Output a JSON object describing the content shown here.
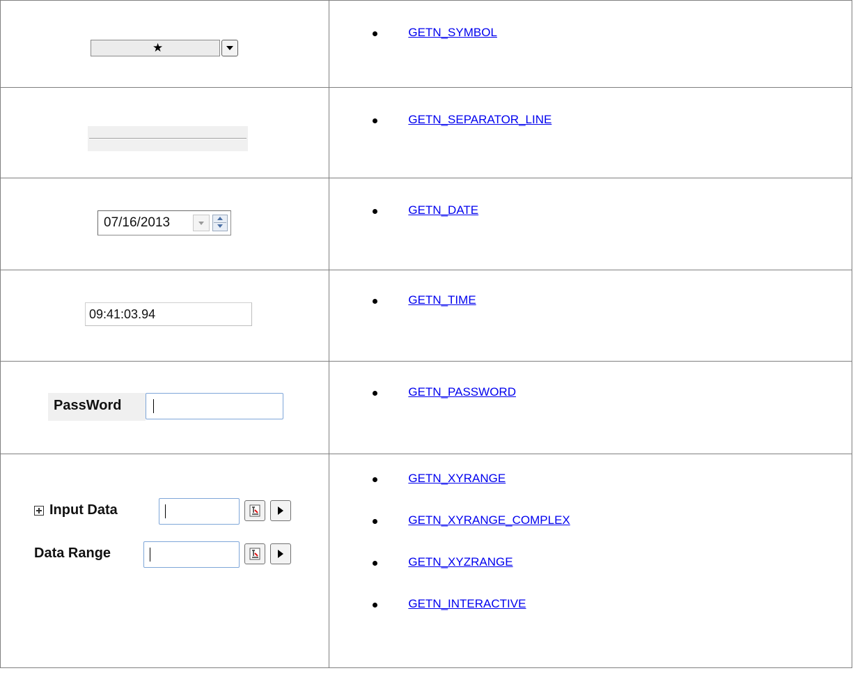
{
  "rows": [
    {
      "control": {
        "type": "symbol",
        "symbol": "★"
      },
      "links": [
        "GETN_SYMBOL"
      ]
    },
    {
      "control": {
        "type": "separator"
      },
      "links": [
        "GETN_SEPARATOR_LINE"
      ]
    },
    {
      "control": {
        "type": "date",
        "value": "07/16/2013"
      },
      "links": [
        "GETN_DATE"
      ]
    },
    {
      "control": {
        "type": "time",
        "value": "09:41:03.94"
      },
      "links": [
        "GETN_TIME"
      ]
    },
    {
      "control": {
        "type": "password",
        "label": "PassWord"
      },
      "links": [
        "GETN_PASSWORD"
      ]
    },
    {
      "control": {
        "type": "range",
        "label_1": "Input Data",
        "label_2": "Data Range"
      },
      "links": [
        "GETN_XYRANGE",
        "GETN_XYRANGE_COMPLEX",
        "GETN_XYZRANGE",
        "GETN_INTERACTIVE"
      ]
    }
  ],
  "colors": {
    "link": "#0000ee",
    "border": "#7f7f7f",
    "field_focus_border": "#7ea6d8"
  },
  "icons": [
    "star-icon",
    "dropdown-arrow-icon",
    "spin-up-icon",
    "spin-down-icon",
    "expand-plus-icon",
    "select-range-icon",
    "play-arrow-icon"
  ]
}
